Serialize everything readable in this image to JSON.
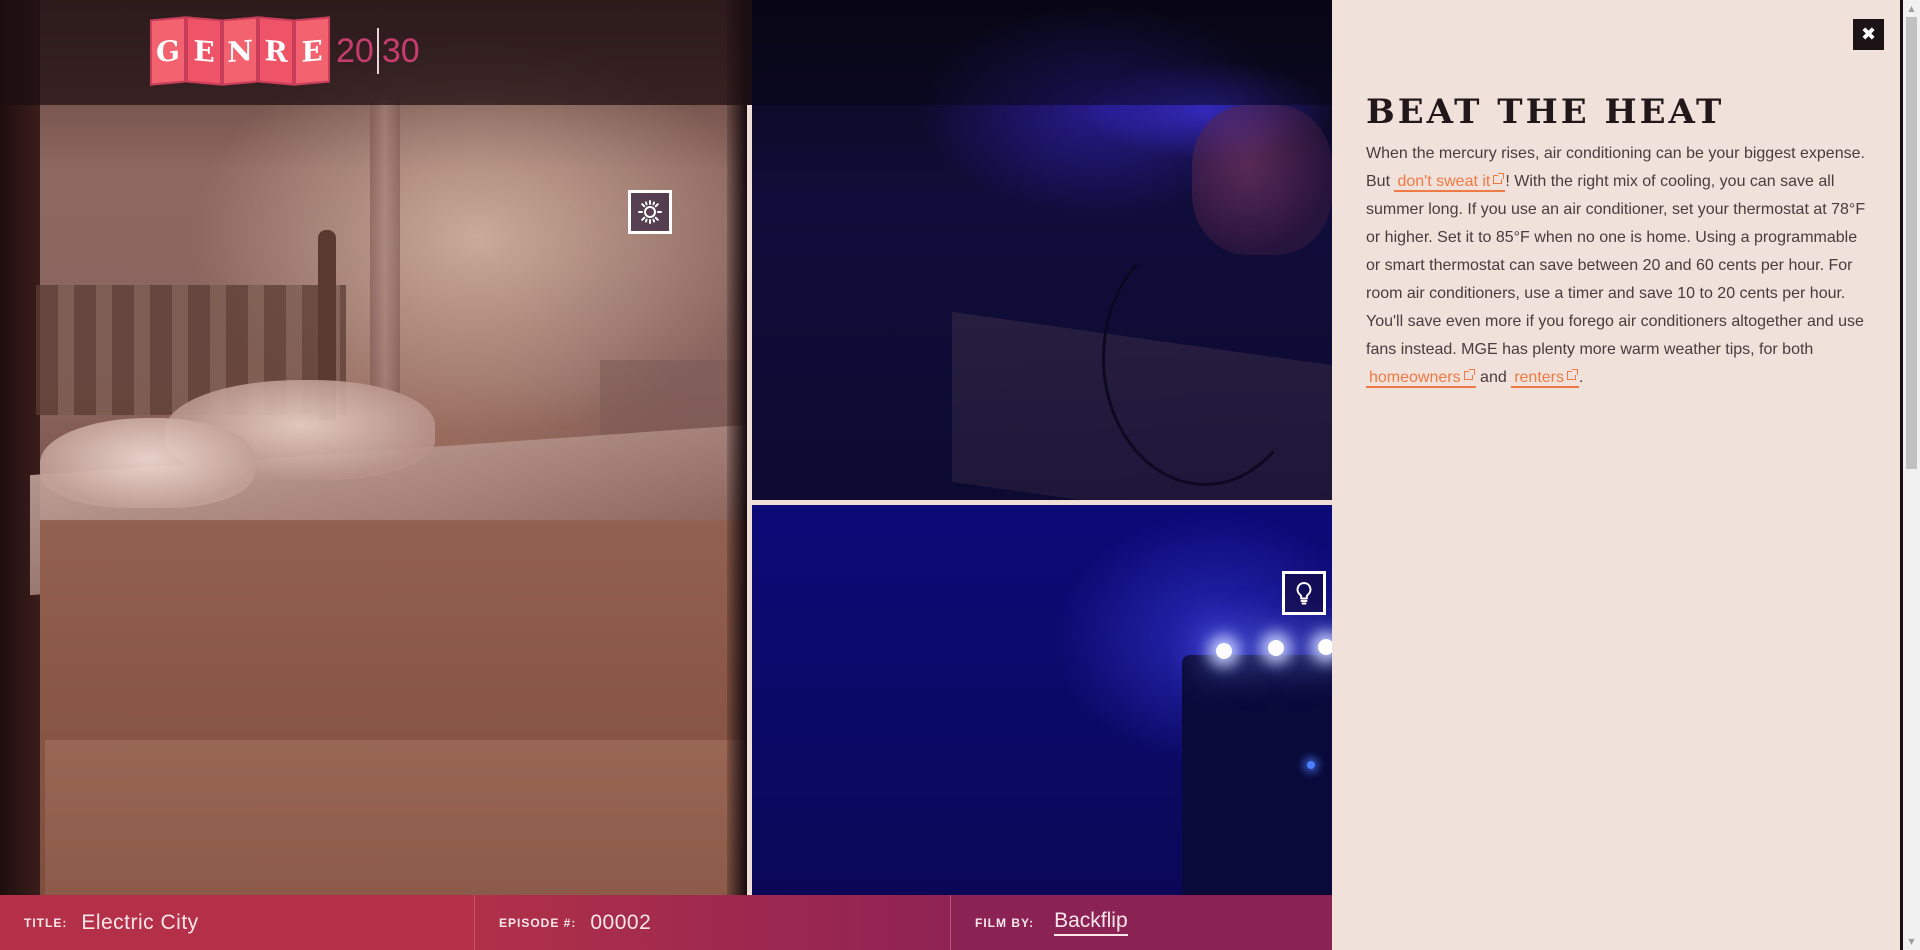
{
  "logo": {
    "letters": [
      "G",
      "E",
      "N",
      "R",
      "E"
    ],
    "year_left": "20",
    "year_right": "30"
  },
  "hotspots": {
    "sun_icon": "sun-icon",
    "bulb_icon": "lightbulb-icon"
  },
  "bottom_bar": {
    "title_label": "TITLE:",
    "title_value": "Electric City",
    "episode_label": "EPISODE #:",
    "episode_value": "00002",
    "film_label": "FILM BY:",
    "film_value": "Backflip"
  },
  "info_panel": {
    "close_label": "✖",
    "heading": "BEAT THE HEAT",
    "body": {
      "part1": "When the mercury rises, air conditioning can be your biggest expense. But ",
      "link1": "don't sweat it",
      "part2": "! With the right mix of cooling, you can save all summer long. If you use an air conditioner, set your thermostat at 78°F or higher. Set it to 85°F when no one is home. Using a programmable or smart thermostat can save between 20 and 60 cents per hour. For room air conditioners, use a timer and save 10 to 20 cents per hour. You'll save even more if you forego air conditioners altogether and use fans instead. MGE has plenty more warm weather tips, for both ",
      "link2": "homeowners",
      "part3": " and ",
      "link3": "renters",
      "part4": "."
    }
  },
  "colors": {
    "accent_orange": "#ee7a45",
    "panel_bg": "#f0e1da",
    "bar_red": "#b42f48",
    "bar_magenta": "#8b2254"
  }
}
